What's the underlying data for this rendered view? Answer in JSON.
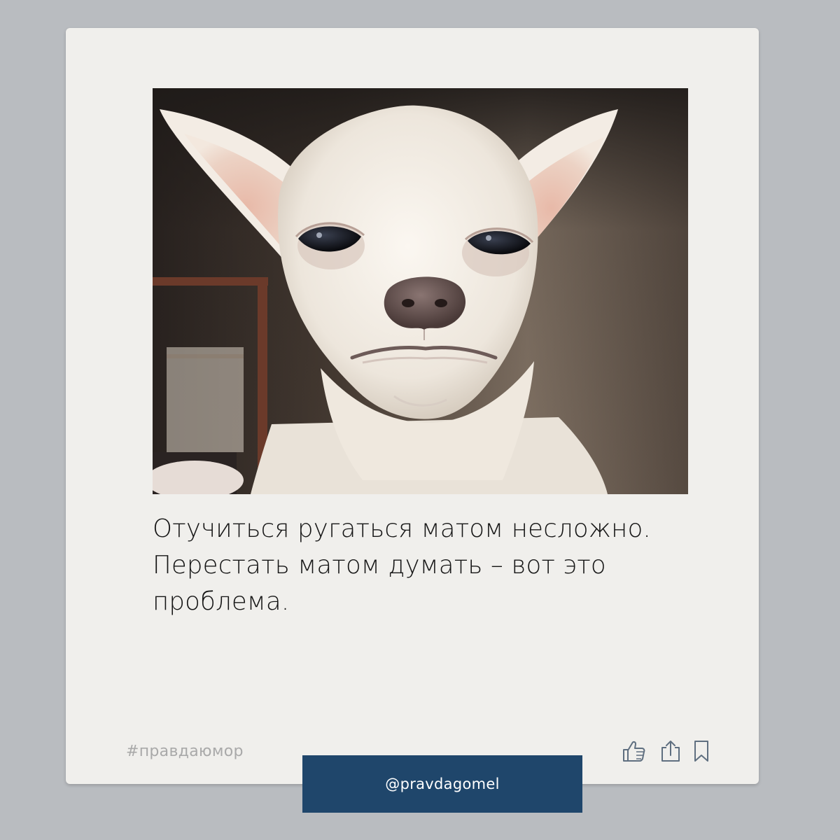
{
  "post": {
    "image": {
      "subject": "white-chihuahua-squinting-photo"
    },
    "caption_lines": [
      "Отучиться ругаться матом несложно.",
      "Перестать матом думать – вот это",
      "проблема."
    ],
    "hashtag": "#правдаюмор",
    "actions": {
      "like_icon": "thumbs-up-icon",
      "share_icon": "share-icon",
      "bookmark_icon": "bookmark-icon"
    }
  },
  "footer": {
    "handle": "@pravdagomel"
  },
  "colors": {
    "page_background": "#b9bcc0",
    "card_background": "#f0efec",
    "handle_bar": "#1f466b",
    "hashtag_text": "#a9a9a9",
    "caption_text": "#161616"
  }
}
